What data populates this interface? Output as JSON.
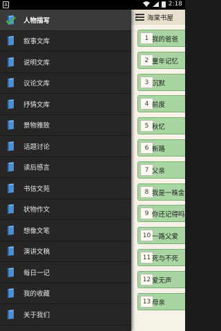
{
  "status": {
    "left_badge": "A",
    "time": "2:18"
  },
  "drawer": {
    "items": [
      {
        "label": "人物描写",
        "icon": "check-book-icon",
        "active": true
      },
      {
        "label": "叙事文库",
        "icon": "book-icon"
      },
      {
        "label": "说明文库",
        "icon": "book-icon"
      },
      {
        "label": "议论文库",
        "icon": "book-icon"
      },
      {
        "label": "抒情文库",
        "icon": "book-icon"
      },
      {
        "label": "景物雅致",
        "icon": "book-icon"
      },
      {
        "label": "话题讨论",
        "icon": "book-icon"
      },
      {
        "label": "读后感言",
        "icon": "book-icon"
      },
      {
        "label": "书信文苑",
        "icon": "book-icon"
      },
      {
        "label": "状物作文",
        "icon": "book-icon"
      },
      {
        "label": "想像文笔",
        "icon": "book-icon"
      },
      {
        "label": "演讲文稿",
        "icon": "book-icon"
      },
      {
        "label": "每日一记",
        "icon": "book-icon"
      },
      {
        "label": "我的收藏",
        "icon": "book-icon"
      },
      {
        "label": "关于我们",
        "icon": "book-icon"
      }
    ]
  },
  "content": {
    "back_glyph": "〈",
    "title": "海棠书屋",
    "articles": [
      {
        "num": "1",
        "title": "我的爸爸"
      },
      {
        "num": "2",
        "title": "童年记忆"
      },
      {
        "num": "3",
        "title": "沉默"
      },
      {
        "num": "4",
        "title": "前度"
      },
      {
        "num": "5",
        "title": "秋忆"
      },
      {
        "num": "6",
        "title": "新路"
      },
      {
        "num": "7",
        "title": "父亲"
      },
      {
        "num": "8",
        "title": "我是一株金"
      },
      {
        "num": "9",
        "title": "你还记得吗"
      },
      {
        "num": "10",
        "title": "一路父爱"
      },
      {
        "num": "11",
        "title": "死与不死"
      },
      {
        "num": "12",
        "title": "爱无声"
      },
      {
        "num": "13",
        "title": "母亲"
      }
    ]
  },
  "colors": {
    "drawer_bg": "#262626",
    "tab_green": "#a8d5a2",
    "content_bg": "#f7f3e8"
  }
}
